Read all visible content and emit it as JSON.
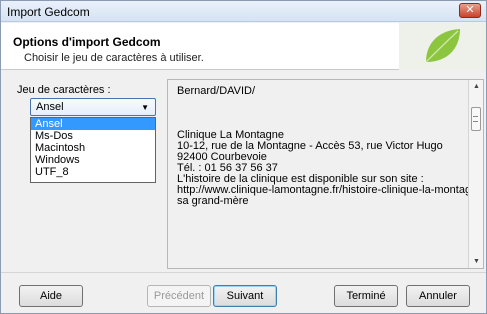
{
  "window": {
    "title": "Import Gedcom",
    "close_label": "✕"
  },
  "header": {
    "title": "Options d'import Gedcom",
    "subtitle": "Choisir le jeu de caractères à utiliser."
  },
  "charset": {
    "label": "Jeu de caractères :",
    "selected": "Ansel",
    "options": [
      "Ansel",
      "Ms-Dos",
      "Macintosh",
      "Windows",
      "UTF_8"
    ]
  },
  "preview": {
    "text": "Bernard/DAVID/\n\n\n\nClinique La Montagne\n10-12, rue de la Montagne - Accès 53, rue Victor Hugo\n92400 Courbevoie\nTél. : 01 56 37 56 37\nL'histoire de la clinique est disponible sur son site :\nhttp://www.clinique-lamontagne.fr/histoire-clinique-la-montagne.htm\nsa grand-mère"
  },
  "buttons": {
    "help": "Aide",
    "previous": "Précédent",
    "next": "Suivant",
    "finish": "Terminé",
    "cancel": "Annuler"
  },
  "colors": {
    "accent": "#3399ff",
    "leaf": "#8cc63f"
  }
}
